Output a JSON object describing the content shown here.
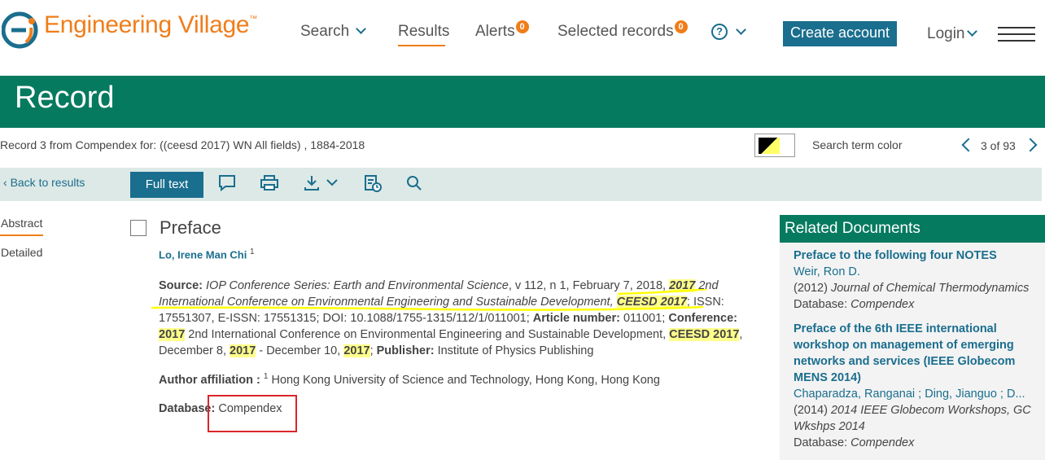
{
  "header": {
    "logo_text": "Engineering Village",
    "logo_tm": "™",
    "nav": {
      "search": "Search",
      "results": "Results",
      "alerts": "Alerts",
      "alerts_count": "0",
      "selected": "Selected records",
      "selected_count": "0"
    },
    "create_account": "Create account",
    "login": "Login"
  },
  "band": {
    "title": "Record"
  },
  "record_bar": {
    "info": "Record 3 from Compendex for: ((ceesd 2017) WN All fields) , 1884-2018",
    "search_term_color": "Search term color",
    "pager": "3 of 93"
  },
  "toolbar": {
    "back": "Back to results",
    "full_text": "Full text"
  },
  "tabs": {
    "abstract": "Abstract",
    "detailed": "Detailed"
  },
  "record": {
    "title": "Preface",
    "author": "Lo, Irene Man Chi",
    "author_sup": "1",
    "source": {
      "label": "Source:",
      "journal": "IOP Conference Series: Earth and Environmental Science",
      "issue": ", v 112, n 1, February 7, 2018, ",
      "hl1": "2017",
      "conf_italic": " 2nd International Conference on Environmental Engineering and Sustainable Development, ",
      "hl2": "CEESD 2017",
      "issn": ";  ISSN: 17551307,  E-ISSN: 17551315;  DOI: 10.1088/1755-1315/112/1/011001;  ",
      "article_label": "Article number:",
      "article": " 011001;  ",
      "conf_label": "Conference:",
      "hl3": "2017",
      "conf_text": " 2nd International Conference on Environmental Engineering and Sustainable Development, ",
      "hl4": "CEESD 2017",
      "dates_a": ", December 8, ",
      "hl5": "2017",
      "dates_b": " - December 10, ",
      "hl6": "2017",
      "pub_sep": "; ",
      "pub_label": "Publisher:",
      "publisher": " Institute of Physics Publishing"
    },
    "affiliation_label": "Author affiliation :",
    "affiliation_sup": "1",
    "affiliation": " Hong Kong University of Science and Technology, Hong Kong, Hong Kong",
    "database_label": "Database:",
    "database": "Compendex"
  },
  "related": {
    "heading": "Related Documents",
    "items": [
      {
        "title": "Preface to the following four NOTES",
        "author": "Weir, Ron D.",
        "year": "(2012)",
        "journal": "Journal of Chemical Thermodynamics",
        "db_label": "Database:",
        "db": "Compendex"
      },
      {
        "title": "Preface of the 6th IEEE international workshop on management of emerging networks and services (IEEE Globecom MENS 2014)",
        "author": "Chaparadza, Ranganai ; Ding, Jianguo ; D...",
        "year": "(2014)",
        "journal": "2014 IEEE Globecom Workshops, GC Wkshps 2014",
        "db_label": "Database:",
        "db": "Compendex"
      }
    ]
  },
  "colors": {
    "accent_orange": "#f07d1a",
    "teal_band": "#057a5f",
    "link_blue": "#1a6e8e",
    "highlight": "#ffff8c"
  }
}
